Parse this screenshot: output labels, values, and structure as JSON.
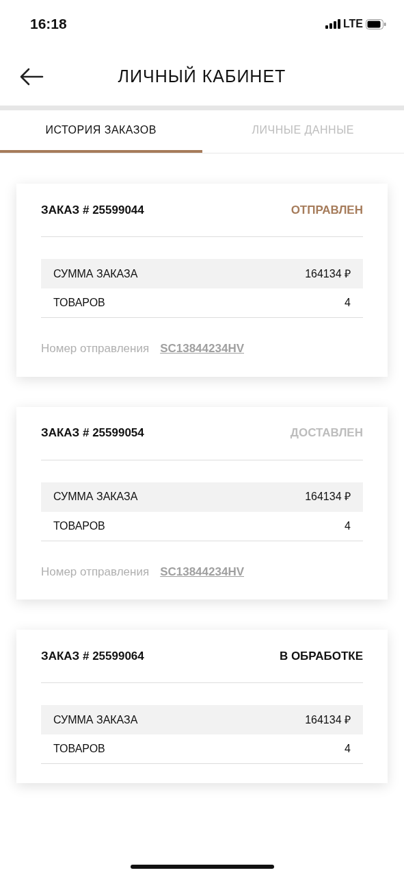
{
  "status_bar": {
    "time": "16:18",
    "network": "LTE"
  },
  "header": {
    "title": "ЛИЧНЫЙ КАБИНЕТ"
  },
  "tabs": [
    {
      "label": "ИСТОРИЯ ЗАКАЗОВ",
      "selected": true
    },
    {
      "label": "ЛИЧНЫЕ ДАННЫЕ",
      "selected": false
    }
  ],
  "orders": [
    {
      "number": "ЗАКАЗ # 25599044",
      "status": "ОТПРАВЛЕН",
      "color": "#a67c5b",
      "sum_label": "СУММА ЗАКАЗА",
      "sum": "164134 ₽",
      "items_label": "ТОВАРОВ",
      "items": "4",
      "tracking_label": "Номер отправления",
      "tracking": "SC13844234HV"
    },
    {
      "number": "ЗАКАЗ # 25599054",
      "status": "ДОСТАВЛЕН",
      "color": "#bdbdbd",
      "sum_label": "СУММА ЗАКАЗА",
      "sum": "164134 ₽",
      "items_label": "ТОВАРОВ",
      "items": "4",
      "tracking_label": "Номер отправления",
      "tracking": "SC13844234HV"
    },
    {
      "number": "ЗАКАЗ # 25599064",
      "status": "В ОБРАБОТКЕ",
      "color": "#111111",
      "sum_label": "СУММА ЗАКАЗА",
      "sum": "164134 ₽",
      "items_label": "ТОВАРОВ",
      "items": "4"
    }
  ]
}
